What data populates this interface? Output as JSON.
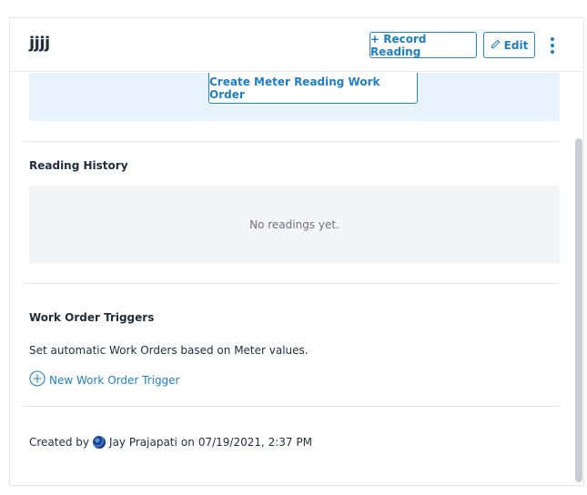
{
  "header": {
    "title": "jjjj",
    "record_button": "+ Record Reading",
    "edit_button": "Edit"
  },
  "work_order": {
    "create_button": "Create Meter Reading Work Order"
  },
  "reading_history": {
    "title": "Reading History",
    "empty_text": "No readings yet."
  },
  "triggers": {
    "title": "Work Order Triggers",
    "description": "Set automatic Work Orders based on Meter values.",
    "new_trigger_link": "New Work Order Trigger"
  },
  "footer": {
    "created_by_label": "Created by",
    "author": "Jay Prajapati",
    "on_label": "on",
    "timestamp": "07/19/2021, 2:37 PM"
  },
  "colors": {
    "accent": "#1e7fc1",
    "info_bg": "#e8f3fd",
    "empty_bg": "#f4f5f7"
  }
}
